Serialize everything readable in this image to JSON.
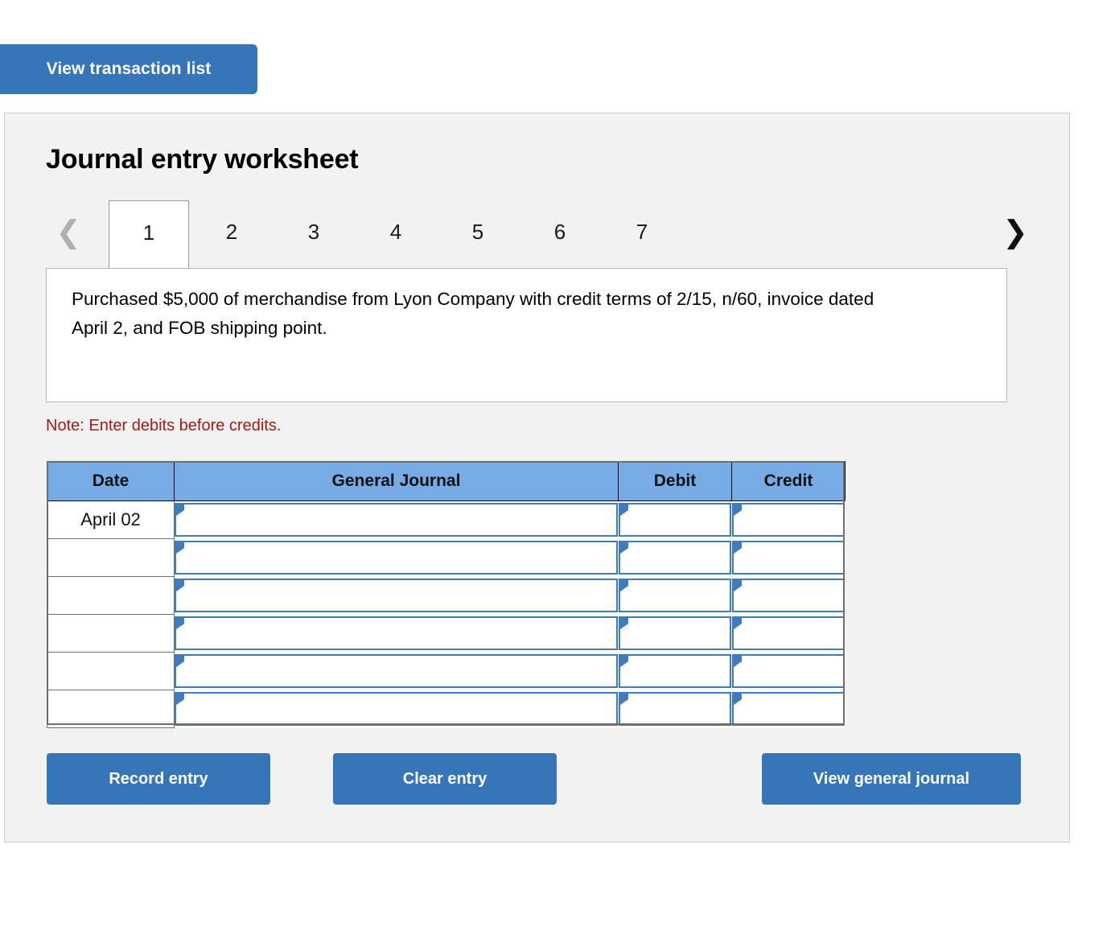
{
  "top": {
    "view_transaction_list_label": "View transaction list"
  },
  "worksheet": {
    "title": "Journal entry worksheet",
    "prev_icon": "chevron-left-icon",
    "next_icon": "chevron-right-icon",
    "tabs": [
      {
        "label": "1",
        "active": true
      },
      {
        "label": "2",
        "active": false
      },
      {
        "label": "3",
        "active": false
      },
      {
        "label": "4",
        "active": false
      },
      {
        "label": "5",
        "active": false
      },
      {
        "label": "6",
        "active": false
      },
      {
        "label": "7",
        "active": false
      }
    ],
    "description": "Purchased $5,000 of merchandise from Lyon Company with credit terms of 2/15, n/60, invoice dated April 2, and FOB shipping point.",
    "note": "Note: Enter debits before credits."
  },
  "journal": {
    "columns": [
      "Date",
      "General Journal",
      "Debit",
      "Credit"
    ],
    "rows": [
      {
        "date": "April 02",
        "account": "",
        "debit": "",
        "credit": ""
      },
      {
        "date": "",
        "account": "",
        "debit": "",
        "credit": ""
      },
      {
        "date": "",
        "account": "",
        "debit": "",
        "credit": ""
      },
      {
        "date": "",
        "account": "",
        "debit": "",
        "credit": ""
      },
      {
        "date": "",
        "account": "",
        "debit": "",
        "credit": ""
      },
      {
        "date": "",
        "account": "",
        "debit": "",
        "credit": ""
      }
    ]
  },
  "actions": {
    "record_entry_label": "Record entry",
    "clear_entry_label": "Clear entry",
    "view_general_journal_label": "View general journal"
  },
  "colors": {
    "button_blue": "#3575B8",
    "header_blue": "#76ABE5",
    "input_border_blue": "#3E7CBD",
    "note_red": "#a31919",
    "panel_bg": "#f2f2f2"
  }
}
